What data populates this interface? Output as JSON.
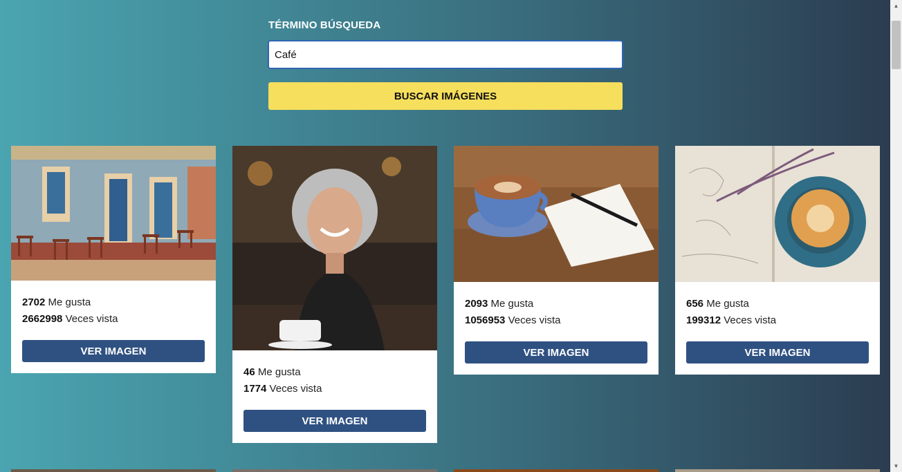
{
  "search": {
    "label": "TÉRMINO BÚSQUEDA",
    "value": "Café",
    "button_label": "BUSCAR IMÁGENES"
  },
  "cards": [
    {
      "likes": "2702",
      "likes_label": "Me gusta",
      "views": "2662998",
      "views_label": "Veces vista",
      "button_label": "VER IMAGEN",
      "image": "cafe-terrace-photo"
    },
    {
      "likes": "46",
      "likes_label": "Me gusta",
      "views": "1774",
      "views_label": "Veces vista",
      "button_label": "VER IMAGEN",
      "image": "smiling-woman-coffee-photo"
    },
    {
      "likes": "2093",
      "likes_label": "Me gusta",
      "views": "1056953",
      "views_label": "Veces vista",
      "button_label": "VER IMAGEN",
      "image": "coffee-cup-notebook-photo"
    },
    {
      "likes": "656",
      "likes_label": "Me gusta",
      "views": "199312",
      "views_label": "Veces vista",
      "button_label": "VER IMAGEN",
      "image": "latte-open-book-photo"
    }
  ],
  "colors": {
    "gradient_start": "#4aa5b1",
    "gradient_end": "#2b3b4f",
    "search_button": "#f6df5c",
    "view_button": "#2f5182",
    "input_border": "#2f66b3"
  }
}
